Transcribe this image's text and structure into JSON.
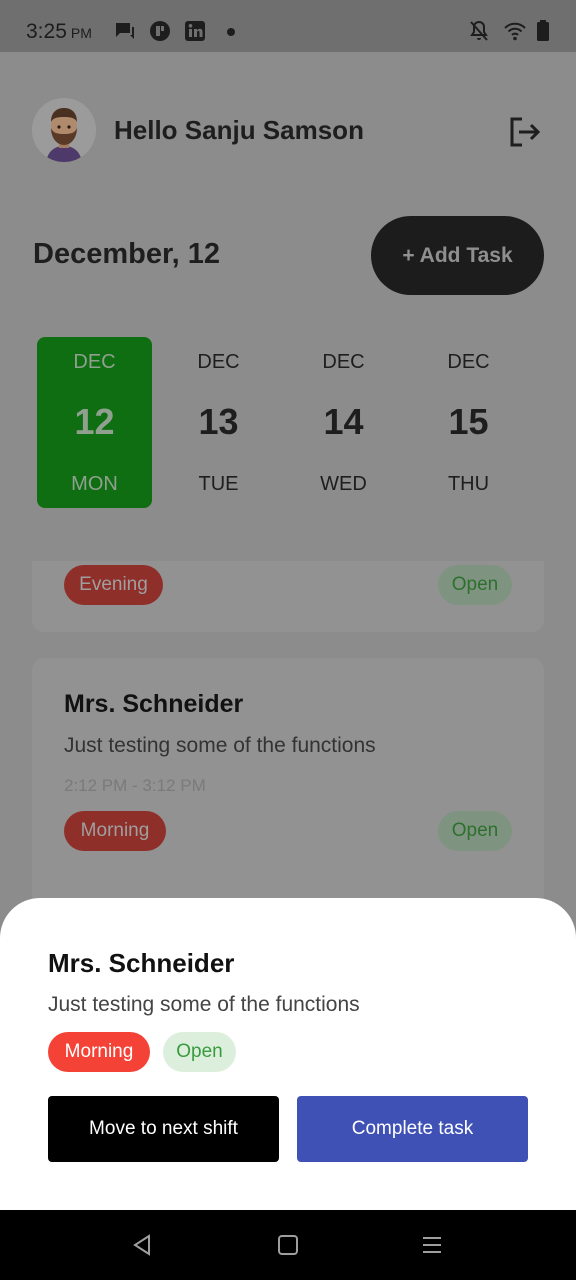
{
  "status_bar": {
    "time": "3:25",
    "ampm": "PM",
    "left_icons": [
      "chat-icon",
      "app-icon",
      "linkedin-icon",
      "dot-icon"
    ],
    "right_icons": [
      "bell-off-icon",
      "wifi-icon",
      "battery-icon"
    ]
  },
  "header": {
    "greeting": "Hello Sanju Samson"
  },
  "date_title": "December, 12",
  "add_task_label": "+ Add Task",
  "days": [
    {
      "month": "DEC",
      "num": "12",
      "weekday": "MON",
      "selected": true
    },
    {
      "month": "DEC",
      "num": "13",
      "weekday": "TUE",
      "selected": false
    },
    {
      "month": "DEC",
      "num": "14",
      "weekday": "WED",
      "selected": false
    },
    {
      "month": "DEC",
      "num": "15",
      "weekday": "THU",
      "selected": false
    }
  ],
  "tasks": [
    {
      "shift": "Evening",
      "status": "Open"
    },
    {
      "title": "Mrs. Schneider",
      "desc": "Just testing some of the functions",
      "time": "2:12 PM - 3:12 PM",
      "shift": "Morning",
      "status": "Open"
    }
  ],
  "sheet": {
    "title": "Mrs. Schneider",
    "desc": "Just testing some of the functions",
    "shift": "Morning",
    "status": "Open",
    "move_label": "Move to next shift",
    "complete_label": "Complete task"
  },
  "colors": {
    "selected_day": "#0e6e11",
    "morning_pill": "#f44336",
    "open_pill_bg": "#dcefdc",
    "complete_button": "#3f51b5"
  }
}
